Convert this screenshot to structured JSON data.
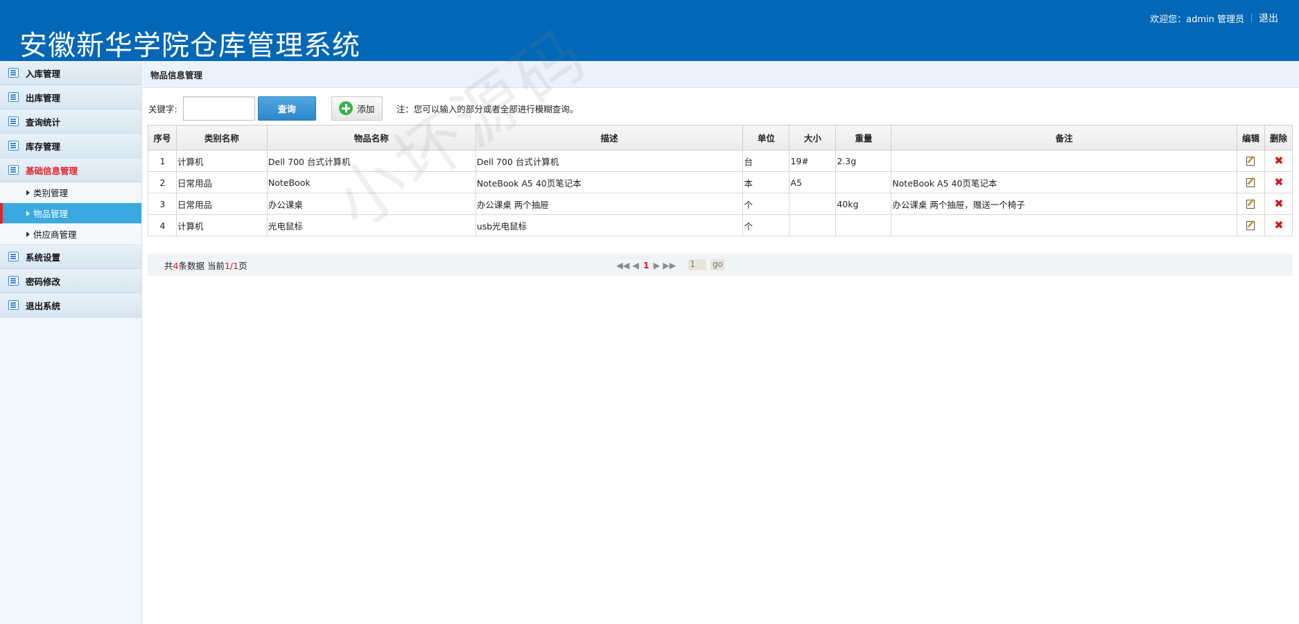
{
  "header": {
    "title": "安徽新华学院仓库管理系统",
    "welcome": "欢迎您：admin 管理员",
    "logout": "退出"
  },
  "sidebar": {
    "items": [
      {
        "label": "入库管理"
      },
      {
        "label": "出库管理"
      },
      {
        "label": "查询统计"
      },
      {
        "label": "库存管理"
      },
      {
        "label": "基础信息管理",
        "active": true
      },
      {
        "label": "系统设置"
      },
      {
        "label": "密码修改"
      },
      {
        "label": "退出系统"
      }
    ],
    "sub_items": [
      {
        "label": "类别管理"
      },
      {
        "label": "物品管理",
        "selected": true
      },
      {
        "label": "供应商管理"
      }
    ]
  },
  "main": {
    "crumb": "物品信息管理",
    "search": {
      "label": "关键字:",
      "value": "",
      "button": "查询",
      "add_button": "添加",
      "note": "注：您可以输入的部分或者全部进行模糊查询。"
    },
    "table": {
      "headers": [
        "序号",
        "类别名称",
        "物品名称",
        "描述",
        "单位",
        "大小",
        "重量",
        "备注",
        "编辑",
        "删除"
      ],
      "rows": [
        [
          "1",
          "计算机",
          "Dell 700 台式计算机",
          "Dell 700 台式计算机",
          "台",
          "19#",
          "2.3g",
          ""
        ],
        [
          "2",
          "日常用品",
          "NoteBook",
          "NoteBook A5 40页笔记本",
          "本",
          "A5",
          "",
          "NoteBook A5 40页笔记本"
        ],
        [
          "3",
          "日常用品",
          "办公课桌",
          "办公课桌 两个抽屉",
          "个",
          "",
          "40kg",
          "办公课桌 两个抽屉，赠送一个椅子"
        ],
        [
          "4",
          "计算机",
          "光电鼠标",
          "usb光电鼠标",
          "个",
          "",
          "",
          ""
        ]
      ]
    },
    "pager": {
      "prefix": "共",
      "total": "4",
      "mid": "条数据 当前",
      "current": "1",
      "slash": "/",
      "pages": "1",
      "suffix": "页",
      "current_page_link": "1",
      "goto_value": "1",
      "go_label": "go"
    }
  },
  "watermark": "小坏源码",
  "colors": {
    "header_bg": "#0167b6",
    "accent_red": "#d4161a",
    "selected_bg": "#3aa9e0"
  }
}
